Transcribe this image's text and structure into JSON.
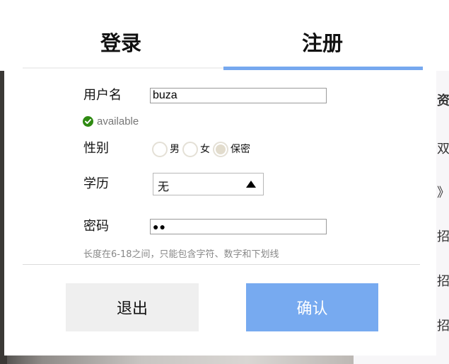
{
  "modal": {
    "tabs": [
      {
        "label": "登录",
        "active": false
      },
      {
        "label": "注册",
        "active": true
      }
    ],
    "form": {
      "username": {
        "label": "用户名",
        "value": "buza"
      },
      "username_status": {
        "text": "available",
        "icon": "check-circle-icon",
        "color": "#2f8a12"
      },
      "gender": {
        "label": "性别",
        "options": [
          "男",
          "女",
          "保密"
        ],
        "selected": "保密"
      },
      "education": {
        "label": "学历",
        "value": "无",
        "icon": "triangle-up-icon"
      },
      "password": {
        "label": "密码",
        "value": "●●"
      },
      "password_hint": "长度在6-18之间，只能包含字符、数字和下划线"
    },
    "buttons": {
      "exit_label": "退出",
      "confirm_label": "确认"
    },
    "colors": {
      "accent": "#76a8ef",
      "confirm_bg": "#77aaf0",
      "exit_bg": "#efefef"
    }
  },
  "background": {
    "right_items": [
      "资",
      "双",
      "》",
      "招",
      "招",
      "招"
    ]
  }
}
